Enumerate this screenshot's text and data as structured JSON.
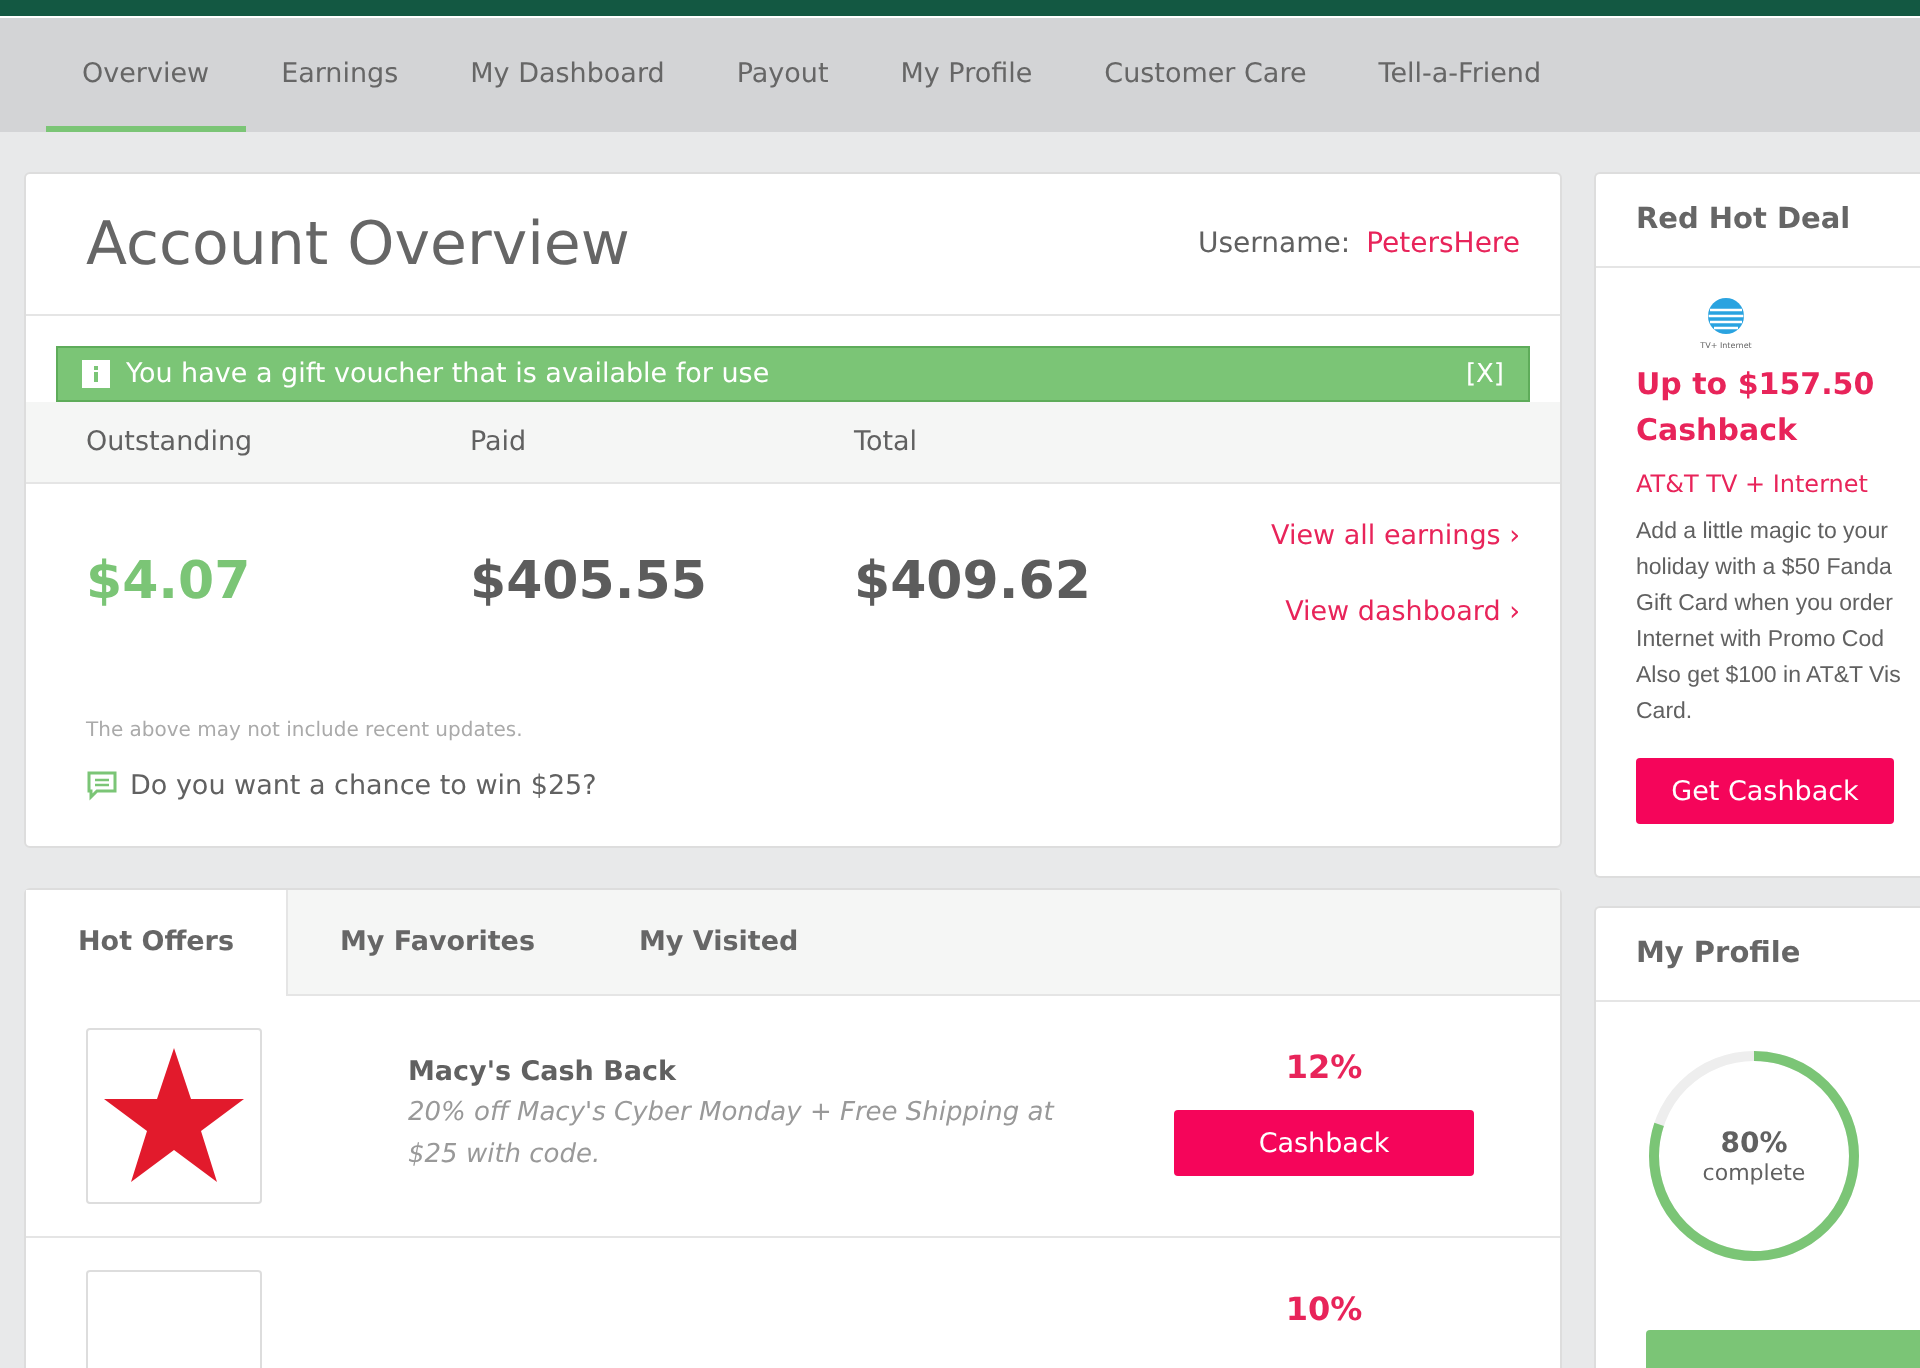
{
  "nav": [
    {
      "label": "Overview",
      "selected": true
    },
    {
      "label": "Earnings",
      "selected": false
    },
    {
      "label": "My Dashboard",
      "selected": false
    },
    {
      "label": "Payout",
      "selected": false
    },
    {
      "label": "My Profile",
      "selected": false
    },
    {
      "label": "Customer Care",
      "selected": false
    },
    {
      "label": "Tell-a-Friend",
      "selected": false
    }
  ],
  "account": {
    "title": "Account Overview",
    "username_label": "Username:",
    "username": "PetersHere",
    "alert": {
      "text": "You have a gift voucher that is available for use",
      "close": "[X]"
    },
    "columns": [
      "Outstanding",
      "Paid",
      "Total"
    ],
    "amounts": [
      "$4.07",
      "$405.55",
      "$409.62"
    ],
    "links": [
      "View all earnings ›",
      "View dashboard ›"
    ],
    "note": "The above may not include recent updates.",
    "prompt": "Do you want a chance to win $25?"
  },
  "offers": {
    "tabs": [
      {
        "label": "Hot Offers",
        "selected": true
      },
      {
        "label": "My Favorites",
        "selected": false
      },
      {
        "label": "My Visited",
        "selected": false
      }
    ],
    "rows": [
      {
        "name": "Macy's Cash Back",
        "description": "20% off Macy's Cyber Monday + Free Shipping at $25 with code.",
        "rate": "12%",
        "button": "Cashback"
      },
      {
        "rate": "10%"
      }
    ]
  },
  "deal": {
    "title": "Red Hot Deal",
    "logo_caption": "TV+ Internet",
    "headline": "Up to $157.50 Cashback",
    "product": "AT&T TV + Internet",
    "description_lines": [
      "Add a little magic to your",
      "holiday with a $50 Fanda",
      "Gift Card when you order",
      "Internet with Promo Cod",
      "Also get $100 in AT&T Vis",
      "Card."
    ],
    "button": "Get Cashback"
  },
  "profile": {
    "title": "My Profile",
    "level": 0.8,
    "percent": "80%",
    "caption": "complete"
  }
}
